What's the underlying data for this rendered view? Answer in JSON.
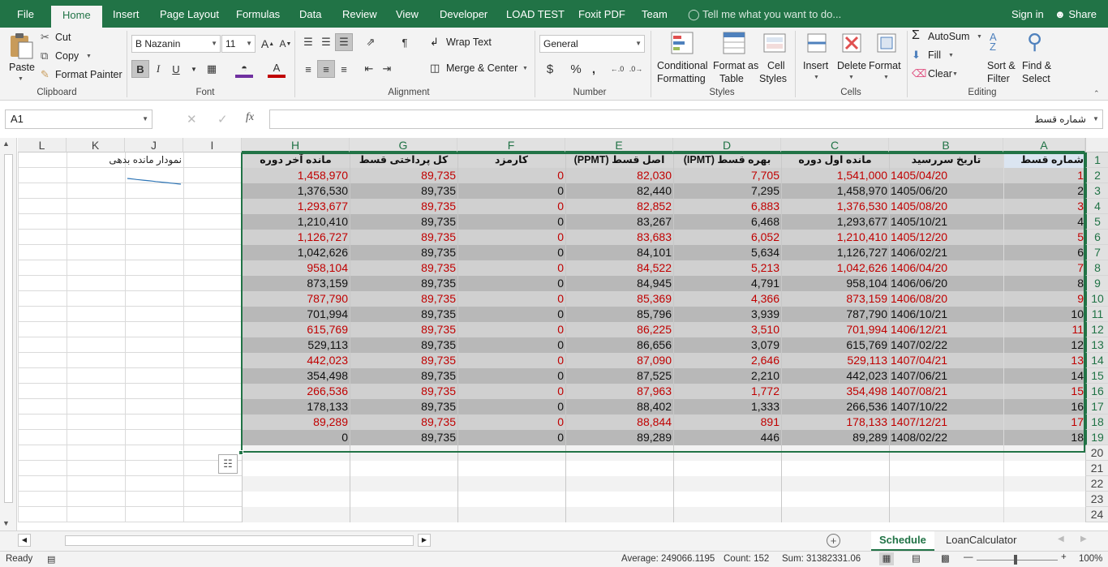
{
  "ribbon_tabs": [
    "File",
    "Home",
    "Insert",
    "Page Layout",
    "Formulas",
    "Data",
    "Review",
    "View",
    "Developer",
    "LOAD TEST",
    "Foxit PDF",
    "Team"
  ],
  "active_tab": "Home",
  "tell_me": "Tell me what you want to do...",
  "sign_in": "Sign in",
  "share": "Share",
  "clipboard": {
    "paste": "Paste",
    "cut": "Cut",
    "copy": "Copy",
    "format_painter": "Format Painter",
    "label": "Clipboard"
  },
  "font": {
    "name": "B Nazanin",
    "size": "11",
    "bold": "B",
    "italic": "I",
    "underline": "U",
    "label": "Font"
  },
  "alignment": {
    "wrap_text": "Wrap Text",
    "merge_center": "Merge & Center",
    "label": "Alignment"
  },
  "number": {
    "format": "General",
    "currency": "$",
    "percent": "%",
    "comma": ",",
    "label": "Number"
  },
  "styles": {
    "conditional_1": "Conditional",
    "conditional_2": "Formatting",
    "format_table_1": "Format as",
    "format_table_2": "Table",
    "cell_styles_1": "Cell",
    "cell_styles_2": "Styles",
    "label": "Styles"
  },
  "cells": {
    "insert": "Insert",
    "delete": "Delete",
    "format": "Format",
    "label": "Cells"
  },
  "editing": {
    "autosum": "AutoSum",
    "fill": "Fill",
    "clear": "Clear",
    "sort_1": "Sort &",
    "sort_2": "Filter",
    "find_1": "Find &",
    "find_2": "Select",
    "label": "Editing"
  },
  "formula_bar": {
    "name_box": "A1",
    "fx": "fx",
    "value": "شماره قسط"
  },
  "columns": [
    "A",
    "B",
    "C",
    "D",
    "E",
    "F",
    "G",
    "H",
    "I",
    "J",
    "K",
    "L"
  ],
  "headers": [
    "شماره قسط",
    "تاریخ سررسید",
    "مانده اول دوره",
    "بهره قسط (IPMT)",
    "اصل قسط (PPMT)",
    "کارمزد",
    "کل پرداختی قسط",
    "مانده آخر دوره"
  ],
  "rows": [
    [
      "1",
      "1405/04/20",
      "1,541,000",
      "7,705",
      "82,030",
      "0",
      "89,735",
      "1,458,970"
    ],
    [
      "2",
      "1405/06/20",
      "1,458,970",
      "7,295",
      "82,440",
      "0",
      "89,735",
      "1,376,530"
    ],
    [
      "3",
      "1405/08/20",
      "1,376,530",
      "6,883",
      "82,852",
      "0",
      "89,735",
      "1,293,677"
    ],
    [
      "4",
      "1405/10/21",
      "1,293,677",
      "6,468",
      "83,267",
      "0",
      "89,735",
      "1,210,410"
    ],
    [
      "5",
      "1405/12/20",
      "1,210,410",
      "6,052",
      "83,683",
      "0",
      "89,735",
      "1,126,727"
    ],
    [
      "6",
      "1406/02/21",
      "1,126,727",
      "5,634",
      "84,101",
      "0",
      "89,735",
      "1,042,626"
    ],
    [
      "7",
      "1406/04/20",
      "1,042,626",
      "5,213",
      "84,522",
      "0",
      "89,735",
      "958,104"
    ],
    [
      "8",
      "1406/06/20",
      "958,104",
      "4,791",
      "84,945",
      "0",
      "89,735",
      "873,159"
    ],
    [
      "9",
      "1406/08/20",
      "873,159",
      "4,366",
      "85,369",
      "0",
      "89,735",
      "787,790"
    ],
    [
      "10",
      "1406/10/21",
      "787,790",
      "3,939",
      "85,796",
      "0",
      "89,735",
      "701,994"
    ],
    [
      "11",
      "1406/12/21",
      "701,994",
      "3,510",
      "86,225",
      "0",
      "89,735",
      "615,769"
    ],
    [
      "12",
      "1407/02/22",
      "615,769",
      "3,079",
      "86,656",
      "0",
      "89,735",
      "529,113"
    ],
    [
      "13",
      "1407/04/21",
      "529,113",
      "2,646",
      "87,090",
      "0",
      "89,735",
      "442,023"
    ],
    [
      "14",
      "1407/06/21",
      "442,023",
      "2,210",
      "87,525",
      "0",
      "89,735",
      "354,498"
    ],
    [
      "15",
      "1407/08/21",
      "354,498",
      "1,772",
      "87,963",
      "0",
      "89,735",
      "266,536"
    ],
    [
      "16",
      "1407/10/22",
      "266,536",
      "1,333",
      "88,402",
      "0",
      "89,735",
      "178,133"
    ],
    [
      "17",
      "1407/12/21",
      "178,133",
      "891",
      "88,844",
      "0",
      "89,735",
      "89,289"
    ],
    [
      "18",
      "1408/02/22",
      "89,289",
      "446",
      "89,289",
      "0",
      "89,735",
      "0"
    ]
  ],
  "row_numbers": [
    "1",
    "2",
    "3",
    "4",
    "5",
    "6",
    "7",
    "8",
    "9",
    "10",
    "11",
    "12",
    "13",
    "14",
    "15",
    "16",
    "17",
    "18",
    "19",
    "20",
    "21",
    "22",
    "23",
    "24"
  ],
  "sparkline_label": "نمودار مانده بدهی",
  "sheets": [
    "Schedule",
    "LoanCalculator"
  ],
  "active_sheet": "Schedule",
  "status": {
    "ready": "Ready",
    "average": "Average: 249066.1195",
    "count": "Count: 152",
    "sum": "Sum: 31382331.06",
    "zoom": "100%"
  },
  "colors": {
    "accent": "#217346",
    "odd_row": "#d0d0d0",
    "even_row": "#b8b8b8",
    "red_text": "#c00000"
  }
}
